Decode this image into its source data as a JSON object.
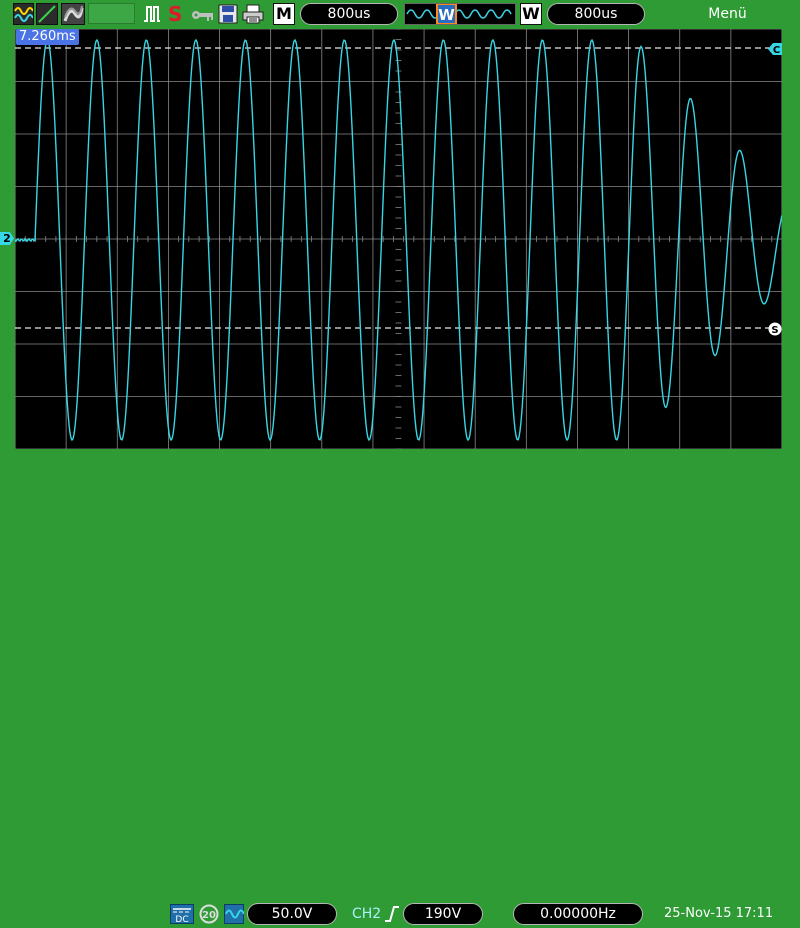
{
  "topbar": {
    "m_label": "M",
    "main_timebase": "800us",
    "window_marker": "W",
    "w_label": "W",
    "window_timebase": "800us",
    "menu_label": "Menü",
    "run_state": "S"
  },
  "screen": {
    "cursor_time": "7.260ms",
    "ch2_marker": "2",
    "cursor_marker_c": "C",
    "cursor_marker_s": "S",
    "trace_color": "#38d6e4",
    "grid_color": "#888888"
  },
  "bottombar": {
    "coupling": "DC",
    "bandwidth_limit": "20",
    "volt_div": "50.0V",
    "trigger_source": "CH2",
    "trigger_level": "190V",
    "frequency": "0.00000Hz",
    "datetime": "25-Nov-15 17:11"
  },
  "colors": {
    "bezel": "#2e9b34",
    "screen": "#000000",
    "trace": "#38d6e4",
    "run_stop": "#e0192b"
  }
}
